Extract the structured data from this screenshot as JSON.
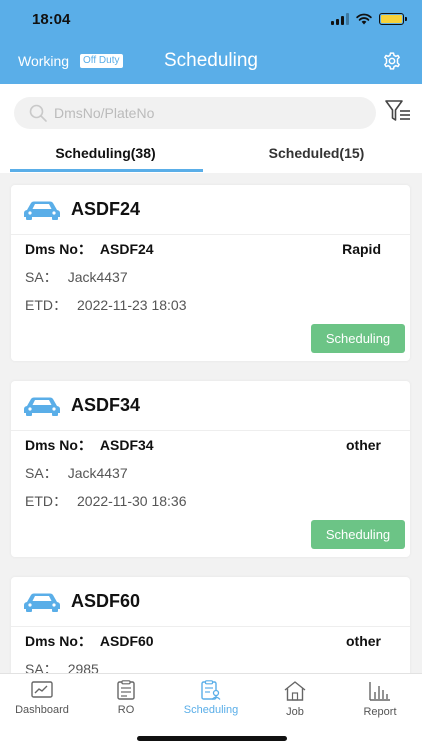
{
  "status_bar": {
    "time": "18:04"
  },
  "nav": {
    "working": "Working",
    "off_duty": "Off Duty",
    "title": "Scheduling"
  },
  "search": {
    "placeholder": "DmsNo/PlateNo",
    "value": ""
  },
  "tabs": [
    {
      "label": "Scheduling(38)"
    },
    {
      "label": "Scheduled(15)"
    }
  ],
  "cards": [
    {
      "plate": "ASDF24",
      "dms_label": "Dms No：",
      "dms_no": "ASDF24",
      "type": "Rapid",
      "sa_label": "SA：",
      "sa": "Jack4437",
      "etd_label": "ETD：",
      "etd": "2022-11-23 18:03",
      "button": "Scheduling"
    },
    {
      "plate": "ASDF34",
      "dms_label": "Dms No：",
      "dms_no": "ASDF34",
      "type": "other",
      "sa_label": "SA：",
      "sa": "Jack4437",
      "etd_label": "ETD：",
      "etd": "2022-11-30 18:36",
      "button": "Scheduling"
    },
    {
      "plate": "ASDF60",
      "dms_label": "Dms No：",
      "dms_no": "ASDF60",
      "type": "other",
      "sa_label": "SA：",
      "sa": "2985"
    }
  ],
  "tabbar": [
    {
      "label": "Dashboard",
      "icon": "dashboard-icon"
    },
    {
      "label": "RO",
      "icon": "clipboard-icon"
    },
    {
      "label": "Scheduling",
      "icon": "scheduling-icon",
      "active": true
    },
    {
      "label": "Job",
      "icon": "home-icon"
    },
    {
      "label": "Report",
      "icon": "report-icon"
    }
  ],
  "colors": {
    "accent": "#5aaee8",
    "button_green": "#6cc486",
    "battery": "#f6d23b"
  }
}
